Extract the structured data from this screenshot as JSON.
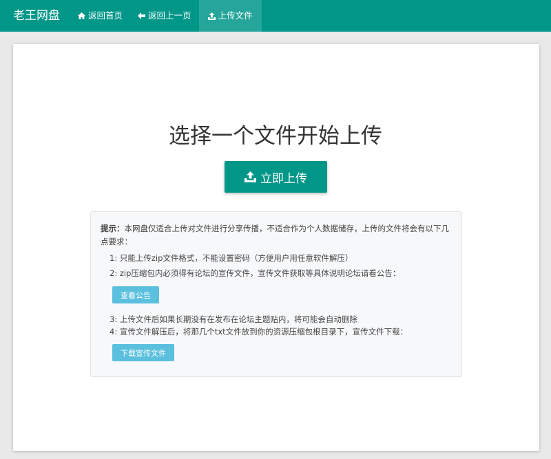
{
  "navbar": {
    "brand": "老王网盘",
    "items": [
      {
        "label": "返回首页",
        "icon": "home-icon"
      },
      {
        "label": "返回上一页",
        "icon": "arrow-left-icon"
      },
      {
        "label": "上传文件",
        "icon": "upload-icon",
        "active": true
      }
    ]
  },
  "main": {
    "title": "选择一个文件开始上传",
    "upload_button": "立即上传"
  },
  "notice": {
    "prefix": "提示：",
    "intro": "本网盘仅适合上传对文件进行分享传播，不适合作为个人数据储存，上传的文件将会有以下几点要求：",
    "rules": [
      "1: 只能上传zip文件格式，不能设置密码（方便用户用任意软件解压）",
      "2: zip压缩包内必须得有论坛的宣传文件，宣传文件获取等具体说明论坛请看公告：",
      "3: 上传文件后如果长期没有在发布在论坛主题贴内，将可能会自动删除",
      "4: 宣传文件解压后，将那几个txt文件放到你的资源压缩包根目录下，宣传文件下载："
    ],
    "view_notice_button": "查看公告",
    "download_button": "下载宣传文件"
  },
  "colors": {
    "primary": "#009688",
    "info": "#5bc0de"
  }
}
